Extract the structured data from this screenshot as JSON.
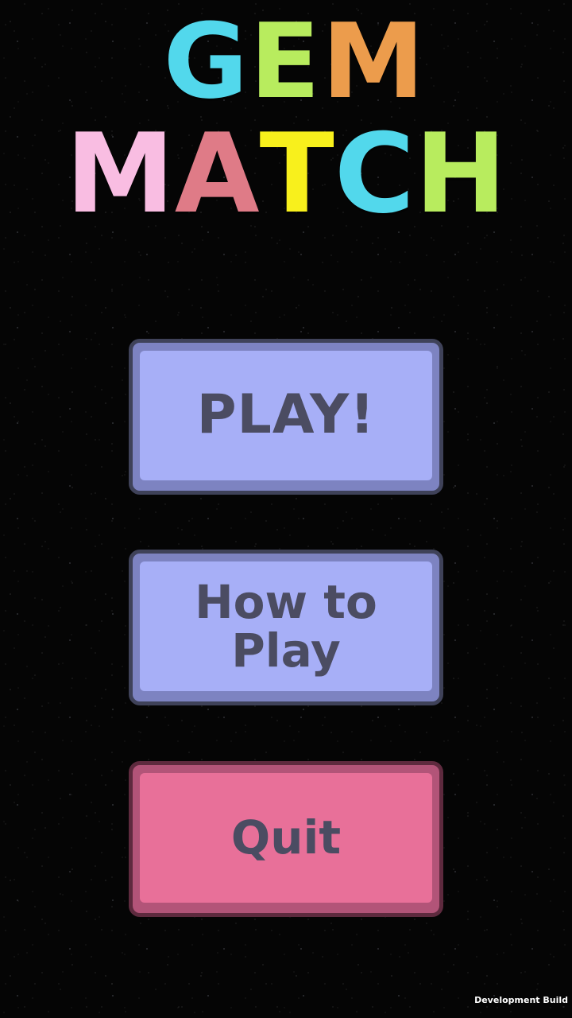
{
  "title": {
    "line1": [
      {
        "char": "G",
        "color": "#52d8ec"
      },
      {
        "char": "E",
        "color": "#b8ec5e"
      },
      {
        "char": "M",
        "color": "#ec9c4c"
      }
    ],
    "line2": [
      {
        "char": "M",
        "color": "#f9bde2"
      },
      {
        "char": "A",
        "color": "#df7b87"
      },
      {
        "char": "T",
        "color": "#f8f01c"
      },
      {
        "char": "C",
        "color": "#52d8ec"
      },
      {
        "char": "H",
        "color": "#b8ec5e"
      }
    ]
  },
  "menu": {
    "play_label": "PLAY!",
    "how_to_play_label": "How to Play",
    "quit_label": "Quit"
  },
  "colors": {
    "primary_button_face": "#a7aff7",
    "primary_button_frame": "#7d83c1",
    "primary_button_border": "#3f4259",
    "quit_button_face": "#e87099",
    "quit_button_frame": "#b25478",
    "quit_button_border": "#5e2a3e",
    "button_text": "#4b4c62"
  },
  "footer": {
    "dev_build_label": "Development Build"
  }
}
